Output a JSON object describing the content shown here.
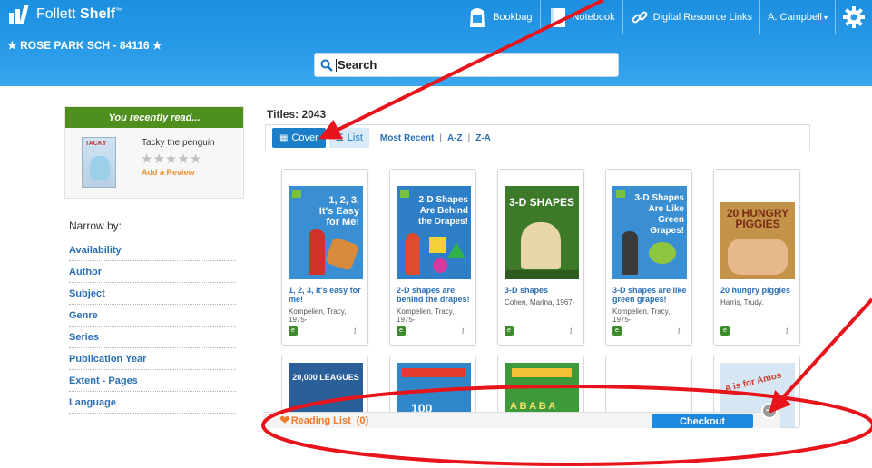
{
  "brand": {
    "name_light": "Follett ",
    "name_bold": "Shelf",
    "tm": "™"
  },
  "school": "★ ROSE PARK SCH - 84116 ★",
  "nav": {
    "bookbag": "Bookbag",
    "notebook": "Notebook",
    "digital": "Digital Resource Links",
    "user": "A. Campbell",
    "user_caret": "▾"
  },
  "search": {
    "value": "Search"
  },
  "recent": {
    "header": "You recently read...",
    "book_title": "Tacky the penguin",
    "cover_text": "TACKY",
    "stars": "★★★★★",
    "add_review": "Add a Review"
  },
  "narrow_by": "Narrow by:",
  "facets": [
    "Availability",
    "Author",
    "Subject",
    "Genre",
    "Series",
    "Publication Year",
    "Extent - Pages",
    "Language"
  ],
  "titles_count": "Titles: 2043",
  "view": {
    "cover_icon": "▦",
    "cover_label": "Cover",
    "list_icon": "☰",
    "list_label": "List",
    "sort_recent": "Most Recent",
    "sep": "|",
    "sort_az": "A-Z",
    "sort_za": "Z-A"
  },
  "books": [
    {
      "title": "1, 2, 3, it's easy for me!",
      "author": "Kompelien, Tracy, 1975-",
      "cover_text": "1, 2, 3, It's Easy for Me!"
    },
    {
      "title": "2-D shapes are behind the drapes!",
      "author": "Kompelien, Tracy, 1975-",
      "cover_text": "2-D Shapes Are Behind the Drapes!"
    },
    {
      "title": "3-D shapes",
      "author": "Cohen, Marina, 1967-",
      "cover_text": "3-D SHAPES"
    },
    {
      "title": "3-D shapes are like green grapes!",
      "author": "Kompelien, Tracy, 1975-",
      "cover_text": "3-D Shapes Are Like Green Grapes!"
    },
    {
      "title": "20 hungry piggies",
      "author": "Harris, Trudy.",
      "cover_text": "20 HUNGRY PIGGIES"
    }
  ],
  "row2_covers": [
    "20,000 LEAGUES",
    "100",
    "A B A B A",
    "",
    "A is for Amos"
  ],
  "reading_list": {
    "heart": "❤",
    "label": "Reading List",
    "count": "(0)"
  },
  "checkout": "Checkout",
  "plus": "+",
  "info_glyph": "i",
  "ebook_glyph": "e",
  "colors": {
    "header": "#2a9be8",
    "link": "#2a6fb5",
    "recent_header": "#4f8f1e",
    "reading_list": "#f07a2a",
    "annotation": "#e8141c"
  }
}
